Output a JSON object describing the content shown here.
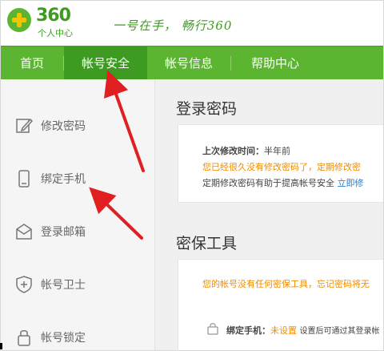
{
  "brand": {
    "number": "360",
    "subtitle": "个人中心",
    "slogan": "一号在手，  畅行360"
  },
  "nav": {
    "items": [
      {
        "label": "首页"
      },
      {
        "label": "帐号安全"
      },
      {
        "label": "帐号信息"
      },
      {
        "label": "帮助中心"
      }
    ],
    "active_index": 1
  },
  "sidebar": {
    "items": [
      {
        "label": "修改密码",
        "icon": "edit-icon"
      },
      {
        "label": "绑定手机",
        "icon": "phone-icon"
      },
      {
        "label": "登录邮箱",
        "icon": "mail-icon"
      },
      {
        "label": "帐号卫士",
        "icon": "shield-plus-icon"
      },
      {
        "label": "帐号锁定",
        "icon": "lock-icon"
      }
    ]
  },
  "login_password": {
    "title": "登录密码",
    "last_changed_label": "上次修改时间：",
    "last_changed_value": "半年前",
    "warning": "您已经很久没有修改密码了，定期修改密",
    "tip": "定期修改密码有助于提高帐号安全",
    "link": "立即修"
  },
  "security_tools": {
    "title": "密保工具",
    "warning": "您的帐号没有任何密保工具，忘记密码将无",
    "bind_label": "绑定手机：",
    "bind_status": "未设置",
    "bind_desc": "设置后可通过其登录帐"
  },
  "colors": {
    "brand_green": "#5cb531",
    "nav_active": "#3e9b21",
    "warning_orange": "#f08c00",
    "link_blue": "#1f7fd8",
    "arrow_red": "#e02020"
  }
}
